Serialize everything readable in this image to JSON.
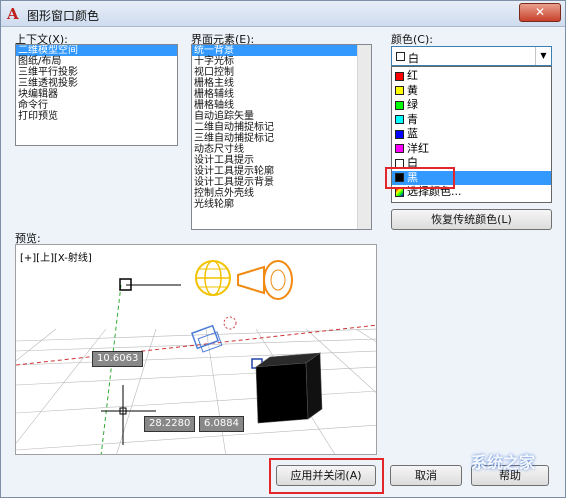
{
  "window": {
    "title": "图形窗口颜色",
    "close_glyph": "✕",
    "app_icon_glyph": "A"
  },
  "context": {
    "label": "上下文(X):",
    "items": [
      "二维模型空间",
      "图纸/布局",
      "三维平行投影",
      "三维透视投影",
      "块编辑器",
      "命令行",
      "打印预览"
    ],
    "selected_index": 0
  },
  "elements": {
    "label": "界面元素(E):",
    "items": [
      "统一背景",
      "十字光标",
      "视口控制",
      "栅格主线",
      "栅格辅线",
      "栅格轴线",
      "自动追踪矢量",
      "二维自动捕捉标记",
      "三维自动捕捉标记",
      "动态尺寸线",
      "设计工具提示",
      "设计工具提示轮廓",
      "设计工具提示背景",
      "控制点外壳线",
      "光线轮廓"
    ],
    "selected_index": 0
  },
  "color": {
    "label": "颜色(C):",
    "current": "白",
    "options": [
      {
        "name": "红",
        "color": "#ff0000"
      },
      {
        "name": "黄",
        "color": "#ffff00"
      },
      {
        "name": "绿",
        "color": "#00ff00"
      },
      {
        "name": "青",
        "color": "#00ffff"
      },
      {
        "name": "蓝",
        "color": "#0000ff"
      },
      {
        "name": "洋红",
        "color": "#ff00ff"
      },
      {
        "name": "白",
        "color": "#ffffff"
      },
      {
        "name": "黑",
        "color": "#000000"
      },
      {
        "name": "选择颜色...",
        "color": "multi"
      }
    ],
    "selected_index": 7
  },
  "restore_button": "恢复传统颜色(L)",
  "preview": {
    "label": "预览:",
    "viewport_label": "[+][上][X-射线]",
    "coord1": "10.6063",
    "coord2": "28.2280",
    "coord3": "6.0884"
  },
  "buttons": {
    "apply": "应用并关闭(A)",
    "cancel": "取消",
    "help": "帮助"
  },
  "watermark": "系统之家"
}
